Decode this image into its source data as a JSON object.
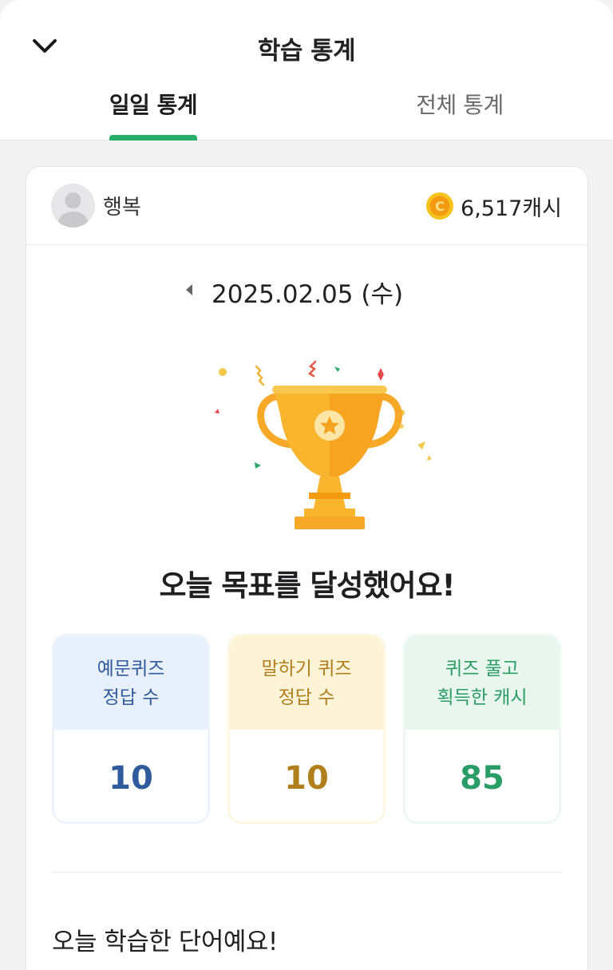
{
  "header": {
    "title": "학습 통계",
    "tabs": [
      {
        "label": "일일 통계",
        "active": true
      },
      {
        "label": "전체 통계",
        "active": false
      }
    ]
  },
  "profile": {
    "name": "행복",
    "cash": "6,517캐시"
  },
  "date": "2025.02.05 (수)",
  "goal_message": "오늘 목표를 달성했어요!",
  "stats": [
    {
      "line1": "예문퀴즈",
      "line2": "정답 수",
      "value": "10"
    },
    {
      "line1": "말하기 퀴즈",
      "line2": "정답 수",
      "value": "10"
    },
    {
      "line1": "퀴즈 풀고",
      "line2": "획득한 캐시",
      "value": "85"
    }
  ],
  "words_section_title": "오늘 학습한 단어예요!",
  "colors": {
    "accent": "#27ae6a",
    "blue": "#2f5b9c",
    "yellow": "#b07e1a",
    "green": "#2a9d66"
  }
}
